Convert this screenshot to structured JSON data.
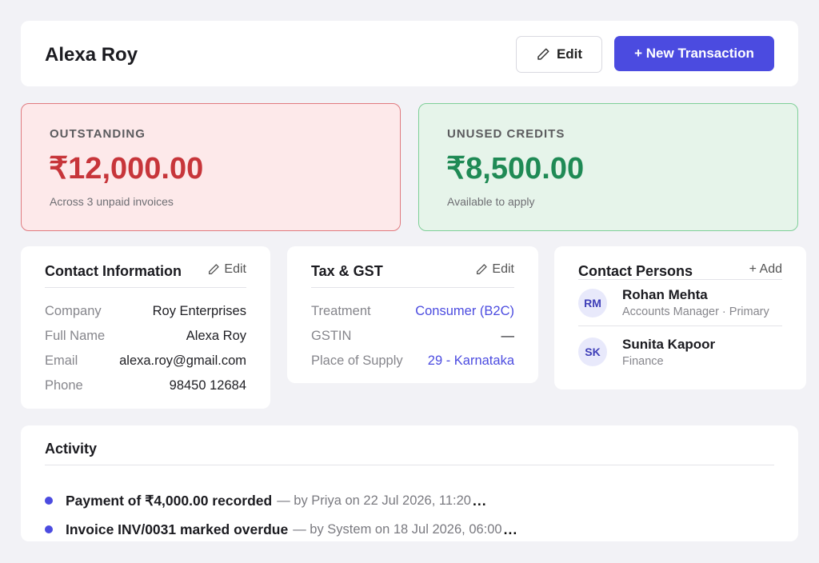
{
  "header": {
    "name": "Alexa Roy",
    "edit_label": "Edit",
    "new_transaction_label": "+ New Transaction",
    "accent_color": "#4b4be0"
  },
  "summary": {
    "outstanding": {
      "label": "OUTSTANDING",
      "amount": "₹12,000.00",
      "note": "Across 3 unpaid invoices",
      "color": "#c7353a"
    },
    "credits": {
      "label": "UNUSED CREDITS",
      "amount": "₹8,500.00",
      "note": "Available to apply",
      "color": "#1f8a55"
    }
  },
  "contact_info": {
    "title": "Contact Information",
    "edit_label": "Edit",
    "edit_icon": "pencil-icon",
    "rows": [
      {
        "label": "Company",
        "value": "Roy Enterprises"
      },
      {
        "label": "Full Name",
        "value": "Alexa Roy"
      },
      {
        "label": "Email",
        "value": "alexa.roy@gmail.com"
      },
      {
        "label": "Phone",
        "value": "98450 12684"
      }
    ]
  },
  "tax_gst": {
    "title": "Tax & GST",
    "edit_label": "Edit",
    "rows": [
      {
        "label": "Treatment",
        "value": "Consumer (B2C)"
      },
      {
        "label": "GSTIN",
        "value": "—"
      },
      {
        "label": "Place of Supply",
        "value": "29 - Karnataka"
      }
    ]
  },
  "contact_persons": {
    "title": "Contact Persons",
    "add_label": "+ Add",
    "people": [
      {
        "initials": "RM",
        "name": "Rohan Mehta",
        "role": "Accounts Manager · Primary"
      },
      {
        "initials": "SK",
        "name": "Sunita Kapoor",
        "role": "Finance"
      }
    ]
  },
  "activity": {
    "title": "Activity",
    "items": [
      {
        "text": "Payment of ₹4,000.00 recorded",
        "meta": "— by Priya on 22 Jul 2026, 11:20",
        "more": "..."
      },
      {
        "text": "Invoice INV/0031 marked overdue",
        "meta": "— by System on 18 Jul 2026, 06:00",
        "more": "..."
      }
    ]
  }
}
